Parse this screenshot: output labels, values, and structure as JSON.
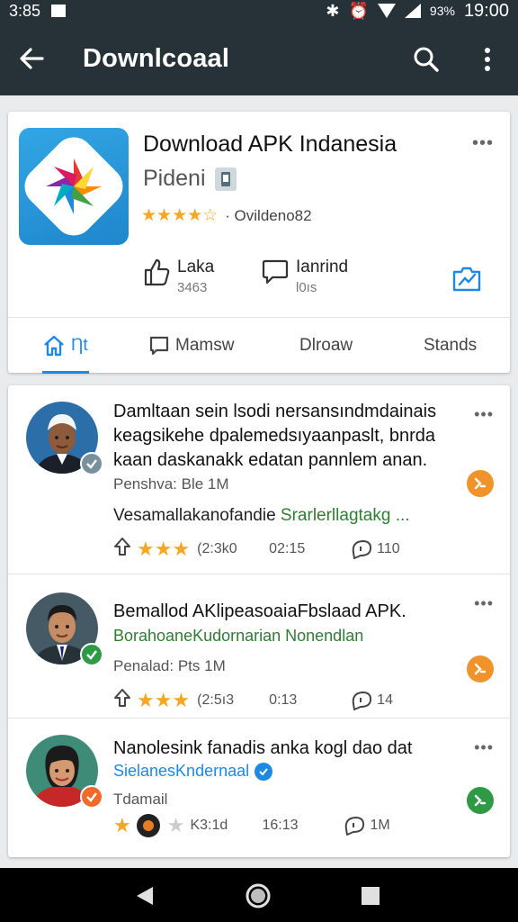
{
  "status_bar": {
    "left_time": "3:85",
    "battery_pct": "93%",
    "time": "19:00"
  },
  "app_bar": {
    "title": "Downlcoaal"
  },
  "app_card": {
    "title": "Download APK Indanesia",
    "developer": "Pideni",
    "rating_stars": "★★★★☆",
    "rating_text": "· Ovildeno82",
    "like_label": "Laka",
    "like_count": "3463",
    "comment_label": "Ianrind",
    "comment_count": "l0ıs",
    "tabs": [
      "Ƞt",
      "Mamsw",
      "Dlroaw",
      "Stands"
    ]
  },
  "posts": [
    {
      "title": "Damltaan sein lsodi nersansındmdainais keagsikehe dpalemedsıyaanpaslt, bnrda kaan daskanakk edatan pannlem anan.",
      "meta": "Penshva: Ble 1M",
      "desc_text": "Vesamallakanofandie ",
      "desc_link": "Srarlerllagtakg ...",
      "stars": "★★★",
      "count": "(2:3k0",
      "time": "02:15",
      "comments": "110",
      "badge_color": "#78909c",
      "action_color": "#f0932b"
    },
    {
      "title": "Bemallod AKlipeasoaiaFbslaad APK.",
      "subtitle": "BorahoaneKudornarian Nonendlan",
      "meta": "Penalad: Pts 1M",
      "stars": "★★★",
      "count": "(2:5ı3",
      "time": "0:13",
      "comments": "14",
      "badge_color": "#2e9a46",
      "action_color": "#f0932b"
    },
    {
      "title": "Nanolesink fanadis anka kogl dao dat",
      "subtitle": "SielanesKndernaal",
      "meta": "Tdamail",
      "stars": "★",
      "count": "K3:1d",
      "time": "16:13",
      "comments": "1M",
      "badge_color": "#f06a2b",
      "action_color": "#2e9a46"
    }
  ],
  "icons": {
    "back": "arrow-left-icon",
    "search": "search-icon",
    "menu": "more-vert-icon"
  }
}
